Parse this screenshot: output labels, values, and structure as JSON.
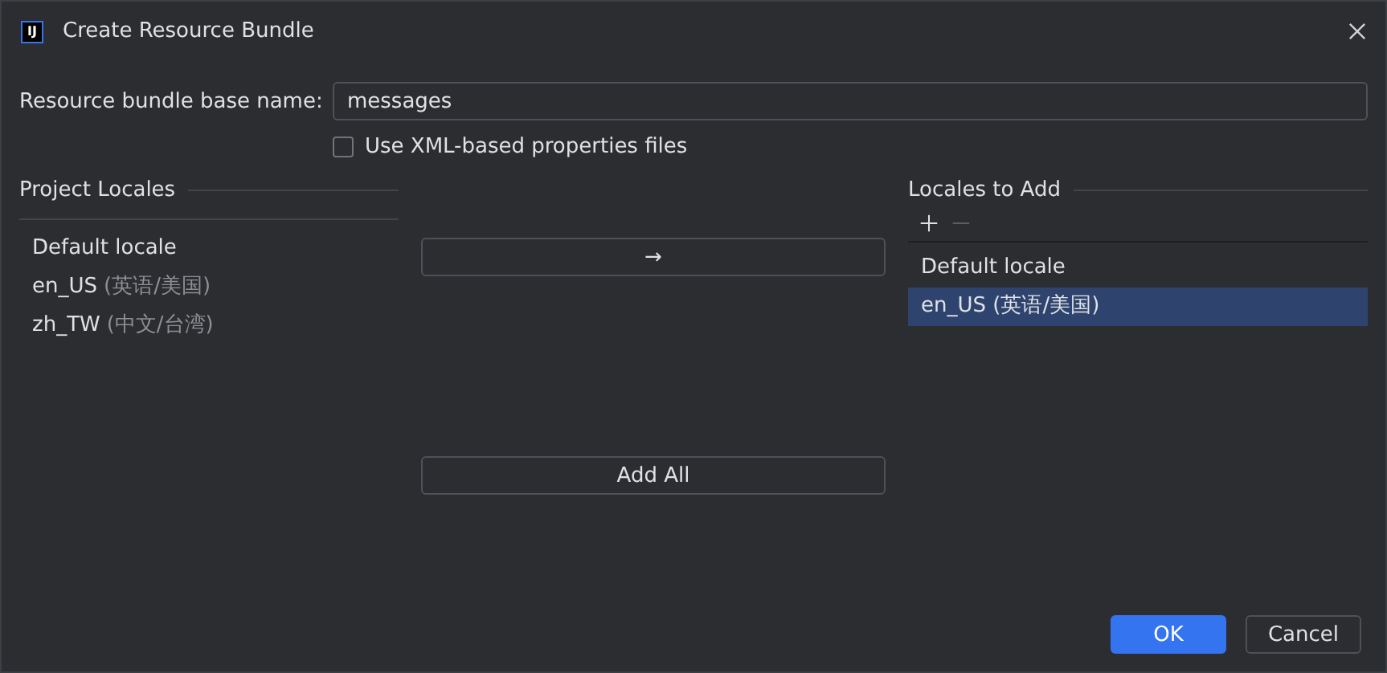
{
  "window": {
    "logo": "IJ",
    "title": "Create Resource Bundle"
  },
  "base_name": {
    "label": "Resource bundle base name:",
    "value": "messages"
  },
  "xml_option": {
    "label": "Use XML-based properties files",
    "checked": false
  },
  "project_locales": {
    "title": "Project Locales",
    "items": [
      {
        "code": "Default locale"
      },
      {
        "code": "en_US",
        "name": "(英语/美国)"
      },
      {
        "code": "zh_TW",
        "name": "(中文/台湾)"
      }
    ]
  },
  "move_button": {
    "label": "→"
  },
  "add_all_button": {
    "label": "Add All"
  },
  "locales_to_add": {
    "title": "Locales to Add",
    "items": [
      {
        "code": "Default locale",
        "selected": false
      },
      {
        "code": "en_US",
        "name": "(英语/美国)",
        "selected": true
      }
    ]
  },
  "buttons": [
    {
      "label": "OK",
      "kind": "primary"
    },
    {
      "label": "Cancel",
      "kind": "secondary"
    }
  ]
}
